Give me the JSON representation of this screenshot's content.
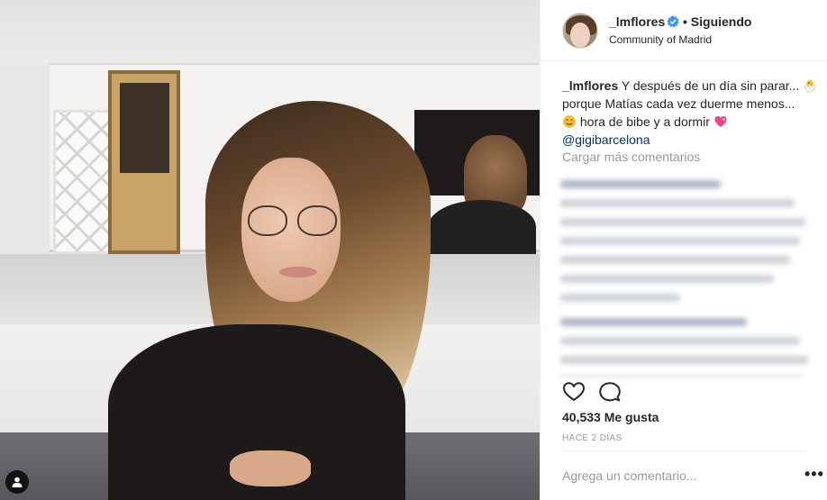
{
  "post": {
    "username": "_lmflores",
    "separator": "•",
    "follow_status": "Siguiendo",
    "location": "Community of Madrid"
  },
  "caption": {
    "username": "_lmflores",
    "line1": " Y después de un día sin parar...",
    "line2": "porque Matías cada vez duerme menos...",
    "line3": " hora de bibe y a dormir ",
    "mention": "@gigibarcelona",
    "emojis": [
      "hatching-chick-emoji",
      "smiling-face-emoji",
      "sparkling-heart-emoji"
    ]
  },
  "comments": {
    "load_more": "Cargar más comentarios"
  },
  "engagement": {
    "likes": "40,533 Me gusta",
    "timestamp": "HACE 2 DÍAS"
  },
  "comment_box": {
    "placeholder": "Agrega un comentario..."
  },
  "more_label": "•••",
  "icons": {
    "verified": "verified-badge-icon",
    "like": "heart-icon",
    "comment": "comment-icon",
    "tagged": "person-tag-icon"
  },
  "colors": {
    "verified": "#3897f0",
    "mention": "#003569",
    "muted": "#999999",
    "text": "#262626"
  }
}
